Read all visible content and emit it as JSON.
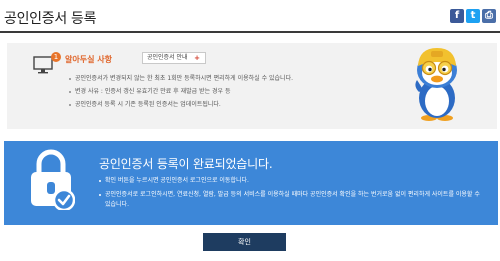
{
  "header": {
    "title": "공인인증서 등록",
    "social": [
      {
        "name": "facebook-icon",
        "glyph": "f",
        "color": "#3b5998"
      },
      {
        "name": "twitter-icon",
        "glyph": "t",
        "color": "#1da1f2"
      },
      {
        "name": "print-icon",
        "glyph": "⎙",
        "color": "#4a6ea8"
      }
    ]
  },
  "notice": {
    "badge": "1",
    "title": "알아두실 사항",
    "guide_label": "공인인증서 안내",
    "guide_plus": "+",
    "items": [
      "공인인증서가 변경되지 않는 한 최초 1회만 등록하시면 편리하게 이용하실 수 있습니다.",
      "변경 사유 : 인증서 갱신 유효기간 만료 후 재발급 받는 경우 등",
      "공인인증서 등록 시 기존 등록된 인증서는 업데이트됩니다."
    ]
  },
  "complete": {
    "title": "공인인증서 등록이 완료되었습니다.",
    "items": [
      "확인 버튼을 누르시면 공인인증서 로그인으로 이동합니다.",
      "공인인증서로 로그인하시면, 연료신청, 열람, 발급 등의 서비스를 이용하실 때마다 공인인증서 확인을 하는 번거로움 없이 편리하게 사이트를 이용할 수 있습니다."
    ]
  },
  "confirm_label": "확인",
  "colors": {
    "complete_bg": "#3d87d8",
    "confirm_bg": "#1e3c60",
    "notice_accent": "#e0652a"
  }
}
